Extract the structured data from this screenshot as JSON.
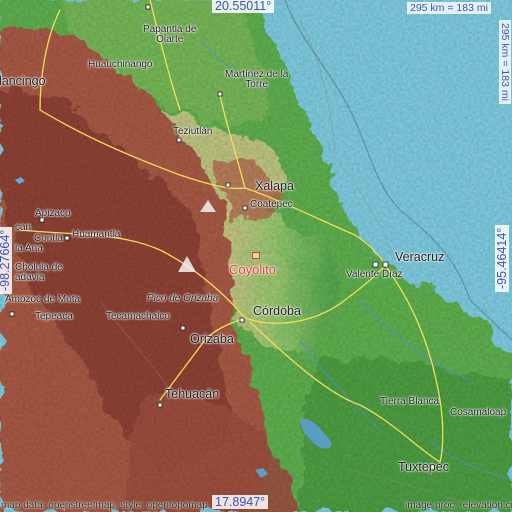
{
  "map": {
    "highlight": {
      "name": "Coyolito",
      "color": "#e33b3b"
    },
    "coords": {
      "top_lat": "20.55011°",
      "bottom_lat": "17.8947°",
      "left_lon": "-98.27664°",
      "right_lon": "-95.46414°",
      "color": "#3a55b8"
    },
    "scale": {
      "horizontal": "295 km = 183 mi",
      "vertical": "295 km = 183 mi"
    },
    "attribution": {
      "left": "map data: openstreetmap, style: opentopomap",
      "right": "image proc.: elevation.city"
    },
    "places": {
      "papantla": [
        "Papantla de",
        "Olarte"
      ],
      "martinez": [
        "Martínez de la",
        "Torre"
      ],
      "huauchinango": "Huauchinango",
      "tlancingo": "lancingo",
      "teziutlan": "Teziutlán",
      "xalapa": "Xalapa",
      "coatepec": "Coatepec",
      "apizaco": "Apizaco",
      "huamantla": "Huamantla",
      "contla": "Contla",
      "can": "can",
      "laana": "la Ana",
      "cholula": [
        "Cholula de",
        "adavia"
      ],
      "amozoc": "Amozoc de Mota",
      "tepeaca": "Tepeaca",
      "tecamachalco": "Tecamachalco",
      "pico": "Pico de Orizaba",
      "orizaba": "Orizaba",
      "cordoba": "Córdoba",
      "veracruz": "Veracruz",
      "valente": "Valente Díaz",
      "tehuacan": "Tehuacán",
      "tierra_blanca": "Tierra Blanca",
      "cosamaloapan": "Cosamaloap",
      "tuxtepec": "Tuxtepec"
    },
    "colors": {
      "sea": "#7fcbe0",
      "lowland": "#5fb04f",
      "midland": "#d8d493",
      "highland": "#a85a45"
    }
  }
}
